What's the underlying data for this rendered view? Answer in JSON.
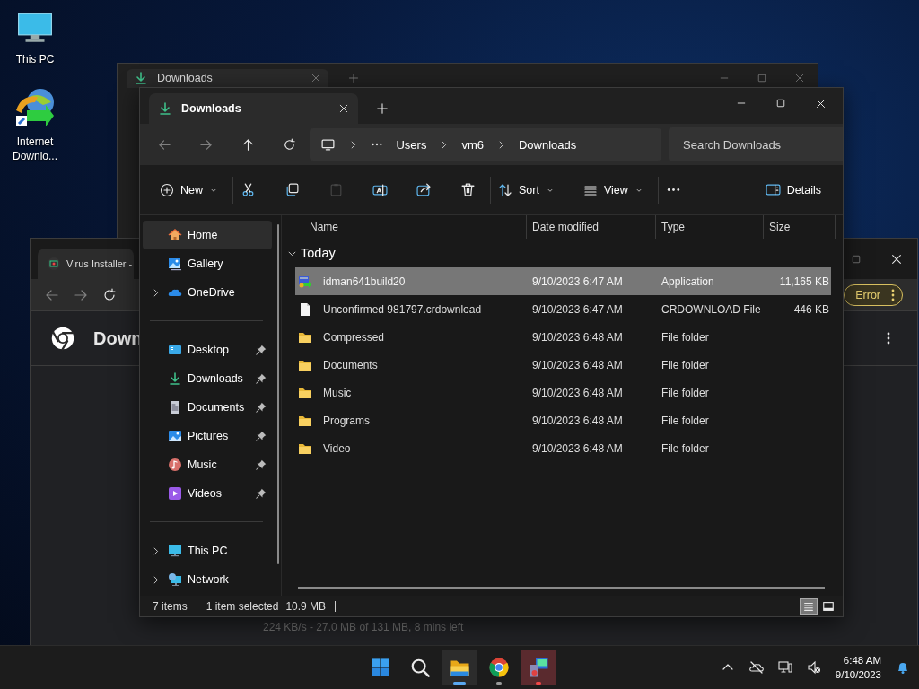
{
  "desktop": {
    "icons": [
      {
        "kind": "computer",
        "label": "This PC"
      },
      {
        "kind": "downloader",
        "label": "Internet Downlo..."
      }
    ]
  },
  "back_window": {
    "tab": "Downloads"
  },
  "browser": {
    "tab": "Virus Installer -",
    "heading": "Down",
    "status_pill": "Error",
    "download_status": "224 KB/s - 27.0 MB of 131 MB, 8 mins left"
  },
  "explorer": {
    "tab": "Downloads",
    "nav": [
      {
        "kind": "back",
        "disabled": true
      },
      {
        "kind": "forward",
        "disabled": true
      },
      {
        "kind": "up",
        "disabled": false
      },
      {
        "kind": "refresh",
        "disabled": false
      }
    ],
    "breadcrumb": [
      "Users",
      "vm6",
      "Downloads"
    ],
    "search": {
      "placeholder": "Search Downloads"
    },
    "toolbar": [
      [
        {
          "kind": "new",
          "label": "New",
          "disabled": false
        }
      ],
      [
        {
          "kind": "cut",
          "disabled": false
        },
        {
          "kind": "copy",
          "disabled": false
        },
        {
          "kind": "paste",
          "disabled": true
        },
        {
          "kind": "rename",
          "disabled": false
        },
        {
          "kind": "share",
          "disabled": false
        },
        {
          "kind": "delete",
          "disabled": false
        }
      ],
      [
        {
          "kind": "sort",
          "label": "Sort",
          "disabled": false
        },
        {
          "kind": "view",
          "label": "View",
          "disabled": false
        }
      ],
      [
        {
          "kind": "more",
          "disabled": false
        }
      ]
    ],
    "details_button": {
      "label": "Details"
    },
    "sidebar": [
      [
        {
          "kind": "home",
          "label": "Home",
          "selected": true,
          "expandable": false,
          "pinned": false
        },
        {
          "kind": "gallery",
          "label": "Gallery",
          "selected": false,
          "expandable": false,
          "pinned": false
        },
        {
          "kind": "cloud",
          "label": "OneDrive",
          "selected": false,
          "expandable": true,
          "pinned": false
        }
      ],
      [
        {
          "kind": "desktop",
          "label": "Desktop",
          "selected": false,
          "expandable": false,
          "pinned": true
        },
        {
          "kind": "downloads",
          "label": "Downloads",
          "selected": false,
          "expandable": false,
          "pinned": true
        },
        {
          "kind": "documents",
          "label": "Documents",
          "selected": false,
          "expandable": false,
          "pinned": true
        },
        {
          "kind": "pictures",
          "label": "Pictures",
          "selected": false,
          "expandable": false,
          "pinned": true
        },
        {
          "kind": "music",
          "label": "Music",
          "selected": false,
          "expandable": false,
          "pinned": true
        },
        {
          "kind": "videos",
          "label": "Videos",
          "selected": false,
          "expandable": false,
          "pinned": true
        }
      ],
      [
        {
          "kind": "thispc",
          "label": "This PC",
          "selected": false,
          "expandable": true,
          "pinned": false
        },
        {
          "kind": "network",
          "label": "Network",
          "selected": false,
          "expandable": true,
          "pinned": false
        }
      ]
    ],
    "columns": [
      "Name",
      "Date modified",
      "Type",
      "Size"
    ],
    "group": {
      "label": "Today",
      "expanded": true
    },
    "rows": [
      {
        "kind": "app",
        "name": "idman641build20",
        "date": "9/10/2023 6:47 AM",
        "type": "Application",
        "size": "11,165 KB",
        "selected": true
      },
      {
        "kind": "file",
        "name": "Unconfirmed 981797.crdownload",
        "date": "9/10/2023 6:47 AM",
        "type": "CRDOWNLOAD File",
        "size": "446 KB",
        "selected": false
      },
      {
        "kind": "folder",
        "name": "Compressed",
        "date": "9/10/2023 6:48 AM",
        "type": "File folder",
        "selected": false
      },
      {
        "kind": "folder",
        "name": "Documents",
        "date": "9/10/2023 6:48 AM",
        "type": "File folder",
        "selected": false
      },
      {
        "kind": "folder",
        "name": "Music",
        "date": "9/10/2023 6:48 AM",
        "type": "File folder",
        "selected": false
      },
      {
        "kind": "folder",
        "name": "Programs",
        "date": "9/10/2023 6:48 AM",
        "type": "File folder",
        "selected": false
      },
      {
        "kind": "folder",
        "name": "Video",
        "date": "9/10/2023 6:48 AM",
        "type": "File folder",
        "selected": false
      }
    ],
    "status": {
      "count": "7 items",
      "selection": "1 item selected",
      "size": "10.9 MB"
    },
    "view_buttons": [
      {
        "kind": "details",
        "selected": true
      },
      {
        "kind": "tiles",
        "selected": false
      }
    ]
  },
  "taskbar": {
    "apps": [
      {
        "kind": "explorer",
        "active": true,
        "attention": false
      },
      {
        "kind": "chrome",
        "active": false,
        "attention": false
      },
      {
        "kind": "installer",
        "active": false,
        "attention": true
      }
    ],
    "tray": [
      {
        "kind": "caret-up"
      },
      {
        "kind": "cloud-off"
      },
      {
        "kind": "network"
      },
      {
        "kind": "volume-muted"
      }
    ],
    "clock": {
      "time": "6:48 AM",
      "date": "9/10/2023"
    }
  }
}
